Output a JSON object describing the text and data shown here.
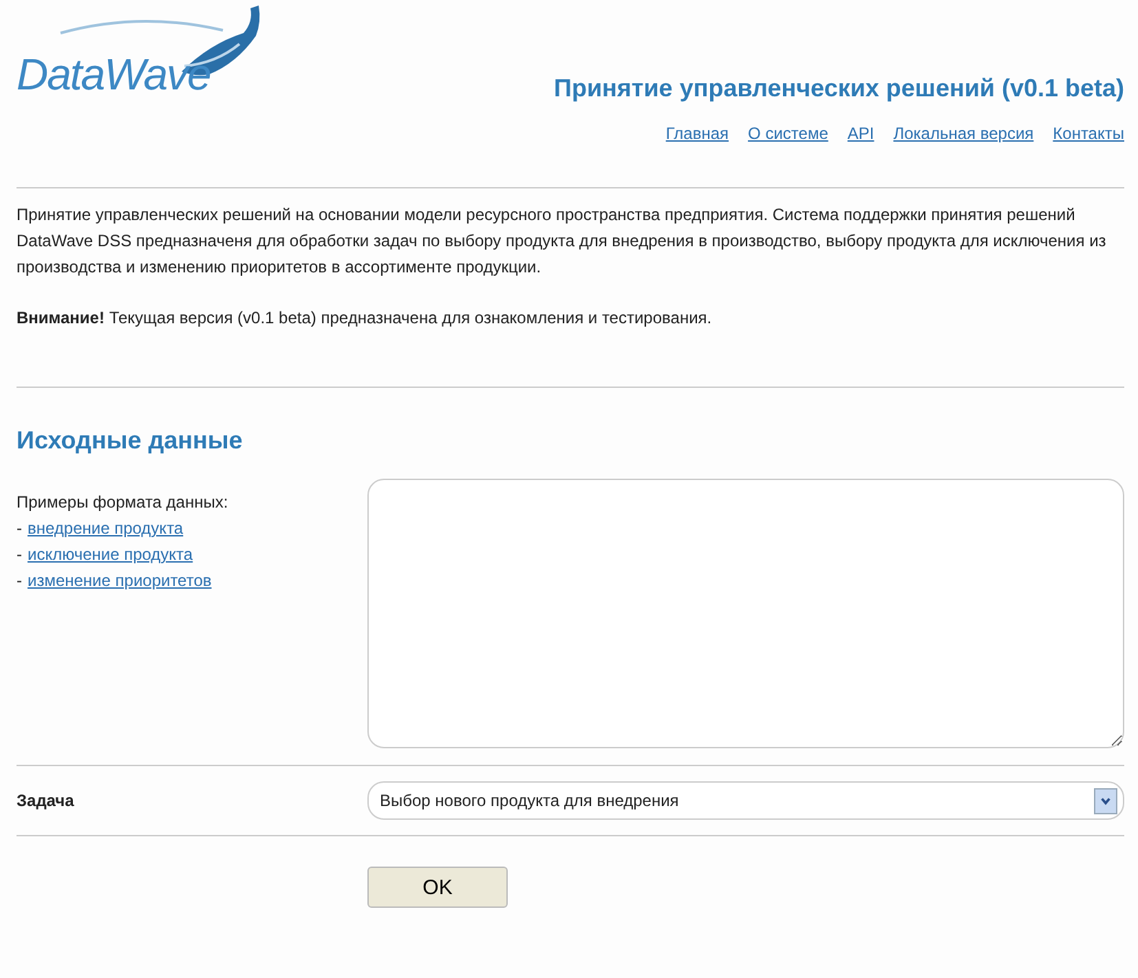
{
  "logo": {
    "text": "DataWave"
  },
  "header": {
    "title": "Принятие управленческих решений (v0.1 beta)"
  },
  "nav": [
    "Главная",
    "О системе",
    "API",
    "Локальная версия",
    "Контакты"
  ],
  "intro": "Принятие управленческих решений на основании модели ресурсного пространства предприятия. Система поддержки принятия решений DataWave DSS предназначеня для обработки задач по выбору продукта для внедрения в производство, выбору продукта для исключения из производства и изменению приоритетов в ассортименте продукции.",
  "notice": "**Внимание!** Текущая версия (v0.1 beta) предназначена для ознакомления и тестирования.",
  "section": {
    "heading": "Исходные данные",
    "examples_label": "Примеры формата данных:",
    "examples": [
      {
        "bullet": "-",
        "label": "внедрение продукта"
      },
      {
        "bullet": "-",
        "label": "исключение продукта"
      },
      {
        "bullet": "-",
        "label": "изменение приоритетов"
      }
    ]
  },
  "task": {
    "label": "Задача",
    "value": "Выбор нового продукта для внедрения"
  },
  "submit": "OK"
}
